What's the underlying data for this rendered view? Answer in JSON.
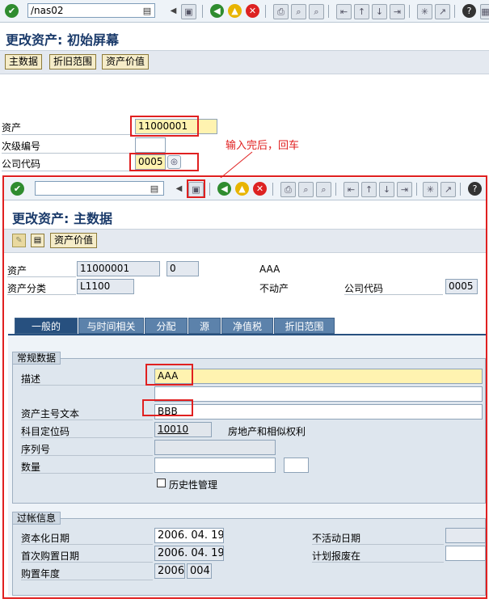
{
  "outer": {
    "command": "/nas02",
    "title": "更改资产: 初始屏幕",
    "buttons": {
      "master": "主数据",
      "depr": "折旧范围",
      "value": "资产价值"
    },
    "labels": {
      "asset": "资产",
      "subnumber": "次级编号",
      "company": "公司代码"
    },
    "values": {
      "asset": "11000001",
      "subnumber": "",
      "company": "0005"
    }
  },
  "annotation": "输入完后，回车",
  "inner": {
    "title": "更改资产: 主数据",
    "buttons": {
      "value": "资产价值"
    },
    "header": {
      "asset_label": "资产",
      "asset_value": "11000001",
      "sub_value": "0",
      "desc_value": "AAA",
      "class_label": "资产分类",
      "class_value": "L1100",
      "class_desc": "不动产",
      "company_label": "公司代码",
      "company_value": "0005"
    },
    "tabs": [
      "一般的",
      "与时间相关",
      "分配",
      "源",
      "净值税",
      "折旧范围"
    ],
    "general": {
      "title": "常规数据",
      "desc_label": "描述",
      "desc_value": "AAA",
      "desc2_value": "",
      "main_text_label": "资产主号文本",
      "main_text_value": "BBB",
      "account_label": "科目定位码",
      "account_value": "10010",
      "account_desc": "房地产和相似权利",
      "serial_label": "序列号",
      "serial_value": "",
      "qty_label": "数量",
      "qty_value": "",
      "qty_unit": "",
      "history_label": "历史性管理"
    },
    "posting": {
      "title": "过帐信息",
      "cap_label": "资本化日期",
      "cap_value": "2006. 04. 19",
      "first_label": "首次购置日期",
      "first_value": "2006. 04. 19",
      "year_label": "购置年度",
      "year_value": "2006",
      "period_value": "004",
      "inactive_label": "不活动日期",
      "inactive_value": "",
      "retire_label": "计划报废在",
      "retire_value": ""
    }
  }
}
